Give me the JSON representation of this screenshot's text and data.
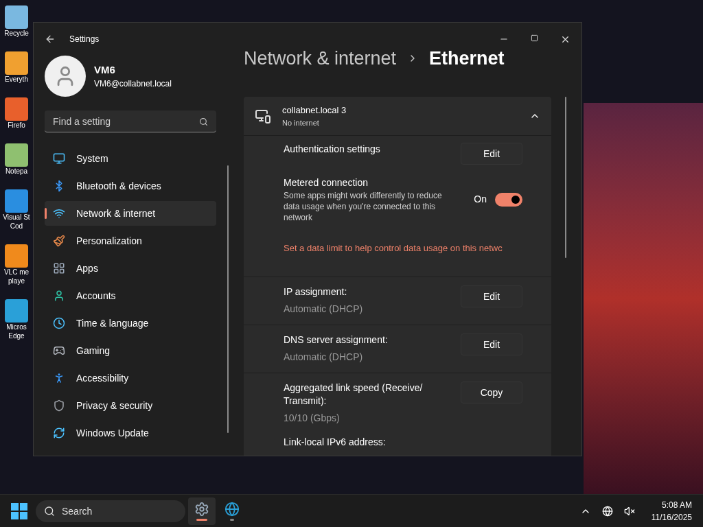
{
  "desktop_icons": [
    {
      "lines": [
        "Recycle"
      ]
    },
    {
      "lines": [
        "Everyth"
      ]
    },
    {
      "lines": [
        "Firefo"
      ]
    },
    {
      "lines": [
        "Notepa"
      ]
    },
    {
      "lines": [
        "Visual St",
        "Cod"
      ]
    },
    {
      "lines": [
        "VLC me",
        "playe"
      ]
    },
    {
      "lines": [
        "Micros",
        "Edge"
      ]
    }
  ],
  "window": {
    "title": "Settings"
  },
  "user": {
    "name": "VM6",
    "email": "VM6@collabnet.local"
  },
  "search": {
    "placeholder": "Find a setting"
  },
  "nav": [
    {
      "label": "System",
      "selected": false
    },
    {
      "label": "Bluetooth & devices",
      "selected": false
    },
    {
      "label": "Network & internet",
      "selected": true
    },
    {
      "label": "Personalization",
      "selected": false
    },
    {
      "label": "Apps",
      "selected": false
    },
    {
      "label": "Accounts",
      "selected": false
    },
    {
      "label": "Time & language",
      "selected": false
    },
    {
      "label": "Gaming",
      "selected": false
    },
    {
      "label": "Accessibility",
      "selected": false
    },
    {
      "label": "Privacy & security",
      "selected": false
    },
    {
      "label": "Windows Update",
      "selected": false
    }
  ],
  "breadcrumb": [
    "Network & internet",
    "Ethernet"
  ],
  "adapter": {
    "name": "collabnet.local 3",
    "status": "No internet",
    "expanded": true
  },
  "rows": [
    {
      "kind": "button",
      "title": "Authentication settings",
      "button": "Edit"
    },
    {
      "kind": "toggle",
      "title": "Metered connection",
      "description": "Some apps might work differently to reduce data usage when you're connected to this network",
      "state_label": "On",
      "on": true
    },
    {
      "kind": "link",
      "text": "Set a data limit to help control data usage on this netwc"
    },
    {
      "kind": "button",
      "title": "IP assignment:",
      "value": "Automatic (DHCP)",
      "button": "Edit"
    },
    {
      "kind": "button",
      "title": "DNS server assignment:",
      "value": "Automatic (DHCP)",
      "button": "Edit"
    },
    {
      "kind": "button",
      "title": "Aggregated link speed (Receive/ Transmit):",
      "value": "10/10 (Gbps)",
      "button": "Copy"
    },
    {
      "kind": "info",
      "title": "Link-local IPv6 address:"
    }
  ],
  "taskbar": {
    "search_placeholder": "Search",
    "apps": [
      {
        "selected": true
      },
      {
        "selected": false
      }
    ],
    "time": "5:08 AM",
    "date": "11/16/2025"
  }
}
